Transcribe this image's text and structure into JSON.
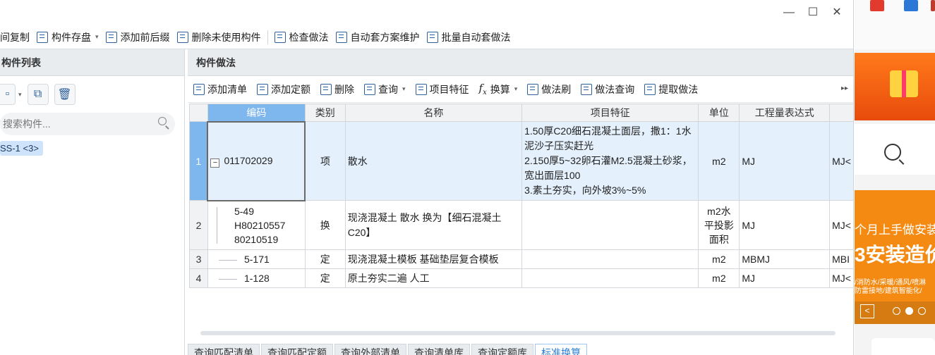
{
  "window": {
    "minimize": "—",
    "maximize": "☐",
    "close": "✕"
  },
  "toolbar": {
    "items": [
      {
        "label": "间复制",
        "icon": "copy-icon"
      },
      {
        "label": "构件存盘",
        "icon": "save-component-icon",
        "caret": "▾"
      },
      {
        "label": "添加前后缀",
        "icon": "add-prefix-icon"
      },
      {
        "label": "删除未使用构件",
        "icon": "delete-unused-icon"
      },
      {
        "label": "检查做法",
        "icon": "check-method-icon"
      },
      {
        "label": "自动套方案维护",
        "icon": "auto-scheme-icon"
      },
      {
        "label": "批量自动套做法",
        "icon": "batch-auto-icon"
      }
    ]
  },
  "left_panel": {
    "title": "构件列表",
    "search_placeholder": "搜索构件...",
    "selected_component": "SS-1 <3>"
  },
  "right_panel": {
    "title": "构件做法",
    "tools": {
      "add_list": "添加清单",
      "add_quota": "添加定额",
      "delete": "删除",
      "query": "查询",
      "item_feature": "项目特征",
      "convert": "换算",
      "method_brush": "做法刷",
      "method_query": "做法查询",
      "extract_method": "提取做法",
      "more": "▸▸"
    },
    "fx_symbol": "f",
    "fx_sub": "x",
    "caret": "▾",
    "columns": [
      "编码",
      "类别",
      "名称",
      "项目特征",
      "单位",
      "工程量表达式"
    ],
    "rows": [
      {
        "num": "1",
        "code": "011702029",
        "expander": "−",
        "type": "项",
        "name": "散水",
        "feature": "1.50厚C20细石混凝土面层，撒1：1水泥沙子压实赶光\n2.150厚5~32卵石灌M2.5混凝土砂浆，宽出面层100\n3.素土夯实，向外坡3%~5%",
        "unit": "m2",
        "expr": "MJ",
        "extra": "MJ<"
      },
      {
        "num": "2",
        "code": "5-49\nH80210557\n80210519",
        "type": "换",
        "name": "现浇混凝土 散水  换为【细石混凝土 C20】",
        "feature": "",
        "unit": "m2水平投影面积",
        "expr": "MJ",
        "extra": "MJ<"
      },
      {
        "num": "3",
        "code": "5-171",
        "type": "定",
        "name": "现浇混凝土模板 基础垫层复合模板",
        "feature": "",
        "unit": "m2",
        "expr": "MBMJ",
        "extra": "MBI"
      },
      {
        "num": "4",
        "code": "1-128",
        "type": "定",
        "name": "原土夯实二遍 人工",
        "feature": "",
        "unit": "m2",
        "expr": "MJ",
        "extra": "MJ<"
      }
    ],
    "bottom_tabs": [
      "查询匹配清单",
      "查询匹配定额",
      "查询外部清单",
      "查询清单库",
      "查询定额库",
      "标准换算"
    ],
    "active_tab": "标准换算"
  },
  "side_panel": {
    "promo_line1": "个月上手做安装",
    "promo_line2": "3安装造价",
    "promo_line3": "/消防水/采暖/通风/喷淋\n防雷接地/建筑智能化/",
    "nav_prev": "<",
    "accent_orange": "#f58a12"
  }
}
